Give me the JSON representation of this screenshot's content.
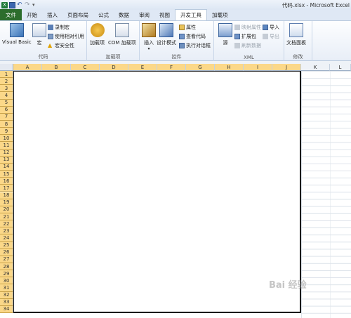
{
  "window": {
    "title": "代码.xlsx - Microsoft Excel"
  },
  "tabs": [
    {
      "label": "文件"
    },
    {
      "label": "开始"
    },
    {
      "label": "插入"
    },
    {
      "label": "页面布局"
    },
    {
      "label": "公式"
    },
    {
      "label": "数据"
    },
    {
      "label": "审阅"
    },
    {
      "label": "视图"
    },
    {
      "label": "开发工具"
    },
    {
      "label": "加载项"
    }
  ],
  "ribbon": {
    "code": {
      "label": "代码",
      "visual_basic": "Visual Basic",
      "macros": "宏",
      "record_macro": "录制宏",
      "relative_refs": "使用相对引用",
      "macro_security": "宏安全性"
    },
    "addins": {
      "label": "加载项",
      "addins": "加载项",
      "com_addins": "COM 加载项"
    },
    "controls": {
      "label": "控件",
      "insert": "插入",
      "design_mode": "设计模式",
      "properties": "属性",
      "view_code": "查看代码",
      "run_dialog": "执行对话框"
    },
    "xml": {
      "label": "XML",
      "source": "源",
      "map_properties": "映射属性",
      "expansion_packs": "扩展包",
      "refresh_data": "刷新数据",
      "import": "导入",
      "export": "导出"
    },
    "modify": {
      "label": "修改",
      "document_panel": "文档面板"
    }
  },
  "sheet": {
    "columns": [
      "A",
      "B",
      "C",
      "D",
      "E",
      "F",
      "G",
      "H",
      "I",
      "J",
      "K",
      "L"
    ],
    "rows": [
      "1",
      "2",
      "3",
      "4",
      "5",
      "6",
      "7",
      "8",
      "9",
      "10",
      "11",
      "12",
      "13",
      "14",
      "15",
      "16",
      "17",
      "18",
      "19",
      "20",
      "21",
      "22",
      "23",
      "24",
      "25",
      "26",
      "27",
      "28",
      "29",
      "30",
      "31",
      "32",
      "33",
      "34"
    ],
    "selected_range": "A1:J34"
  },
  "watermark": "Bai 经验"
}
